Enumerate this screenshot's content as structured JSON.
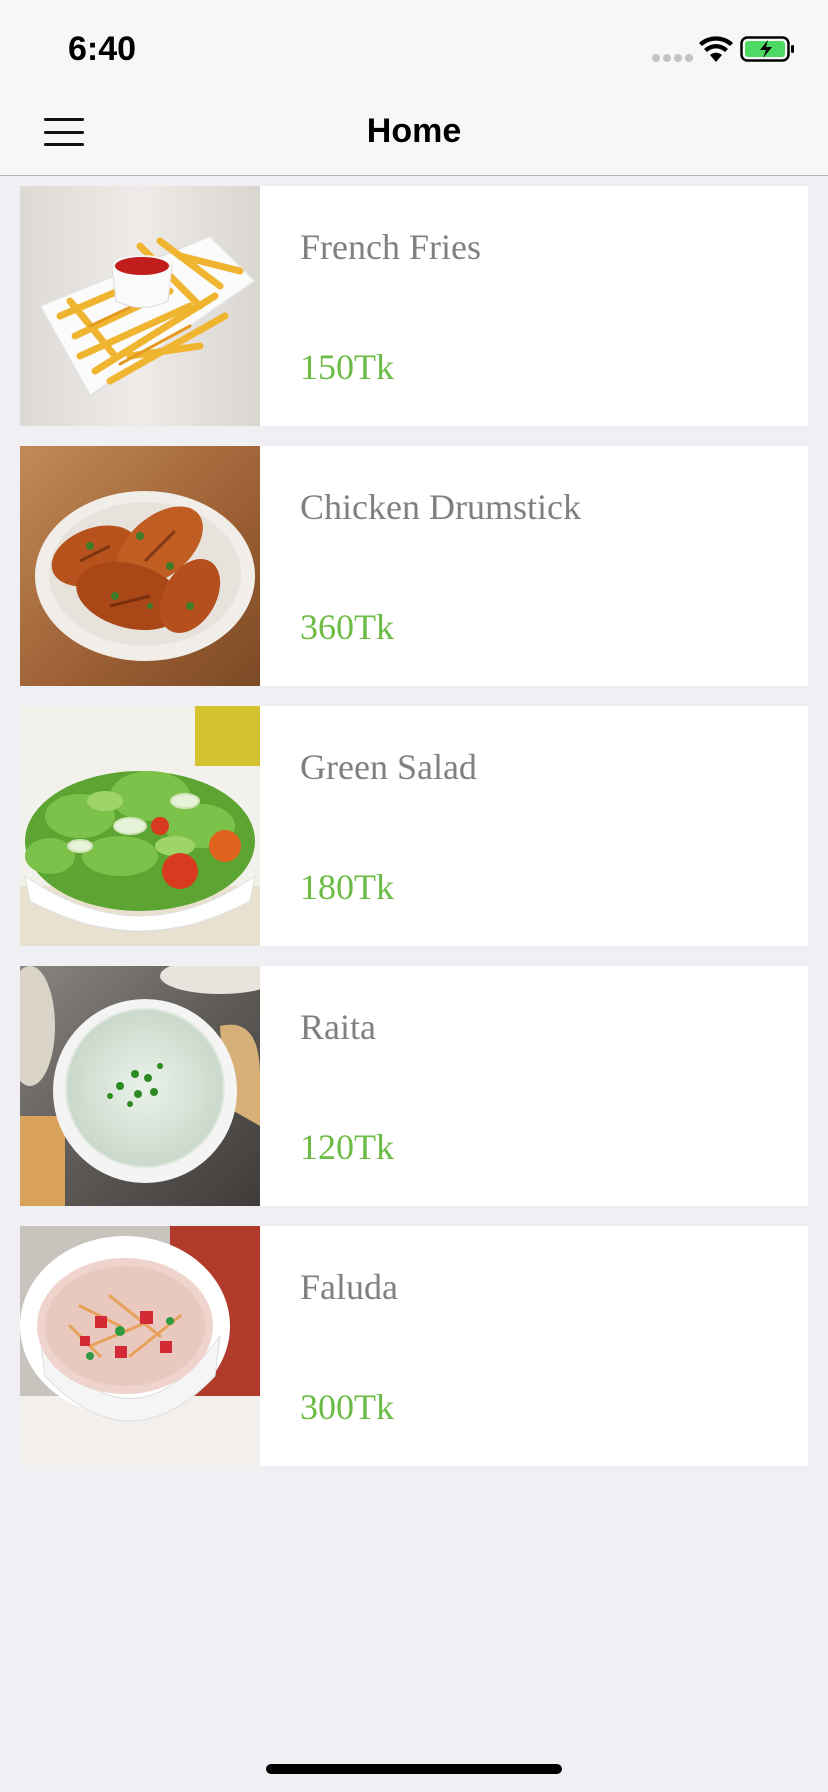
{
  "status": {
    "time": "6:40"
  },
  "nav": {
    "title": "Home",
    "menu_icon": "hamburger-menu-icon"
  },
  "items": [
    {
      "name": "French Fries",
      "price": "150Tk",
      "image": "french-fries-image"
    },
    {
      "name": "Chicken Drumstick",
      "price": "360Tk",
      "image": "chicken-drumstick-image"
    },
    {
      "name": "Green Salad",
      "price": "180Tk",
      "image": "green-salad-image"
    },
    {
      "name": "Raita",
      "price": "120Tk",
      "image": "raita-image"
    },
    {
      "name": "Faluda",
      "price": "300Tk",
      "image": "faluda-image"
    }
  ],
  "colors": {
    "background": "#efeff4",
    "name_text": "#808080",
    "price_text": "#6bbb45",
    "bar": "#f7f7f8"
  }
}
